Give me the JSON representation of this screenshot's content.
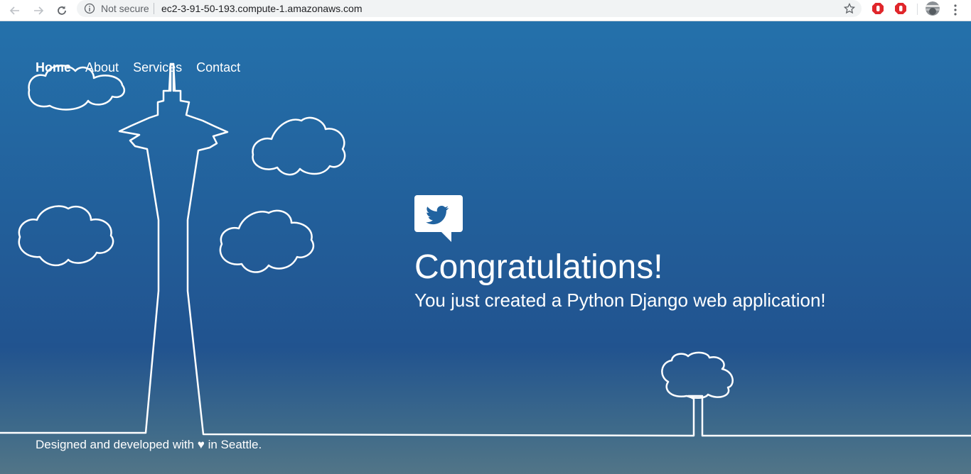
{
  "browser": {
    "security_label": "Not secure",
    "url": "ec2-3-91-50-193.compute-1.amazonaws.com",
    "icons": [
      "back-arrow-icon",
      "forward-arrow-icon",
      "reload-icon",
      "info-icon",
      "star-icon",
      "adblock-icon",
      "adblock-plus-icon",
      "profile-avatar",
      "menu-icon"
    ]
  },
  "nav": {
    "items": [
      {
        "label": "Home",
        "active": true
      },
      {
        "label": "About",
        "active": false
      },
      {
        "label": "Services",
        "active": false
      },
      {
        "label": "Contact",
        "active": false
      }
    ]
  },
  "hero": {
    "icon": "twitter-bird-icon",
    "title": "Congratulations!",
    "subtitle": "You just created a Python Django web application!"
  },
  "footer": {
    "text": "Designed and developed with ♥ in Seattle."
  },
  "colors": {
    "page_top": "#2471ab",
    "page_mid": "#21538f",
    "page_bottom": "#527587",
    "line": "#ffffff",
    "adblock_red": "#e0262b"
  }
}
